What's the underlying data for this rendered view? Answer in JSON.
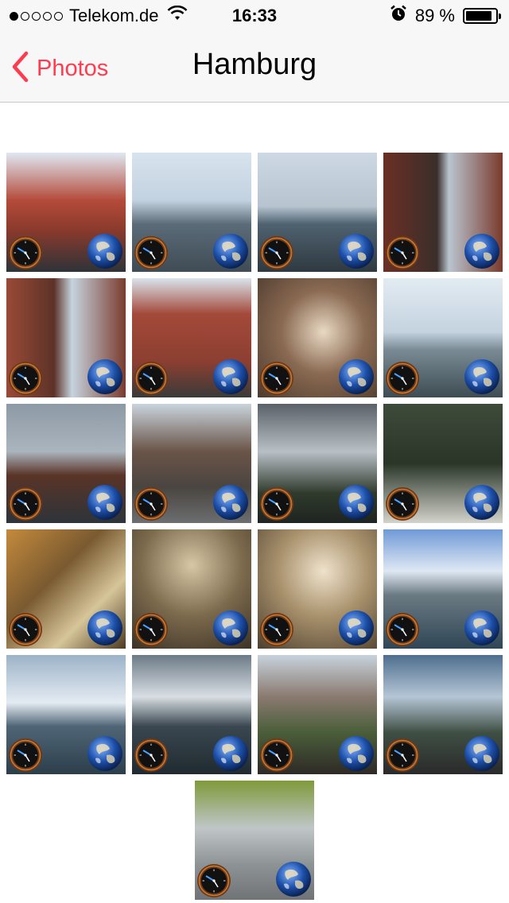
{
  "status_bar": {
    "carrier": "Telekom.de",
    "signal_filled": 1,
    "signal_total": 5,
    "time": "16:33",
    "battery": "89 %",
    "battery_level": 0.89
  },
  "nav": {
    "back_label": "Photos",
    "title": "Hamburg",
    "accent": "#ff3b4f"
  },
  "badges": {
    "left": "clock-icon",
    "right": "globe-icon"
  },
  "photos": [
    {
      "bg": "linear-gradient(#2f3a40 0%, #1d2426 100%)"
    },
    {
      "bg": "linear-gradient(#3b4a2c 0%, #2a3620 100%)"
    },
    {
      "bg": "linear-gradient(#5a6470 0%, #2c3136 100%)"
    },
    {
      "bg": "linear-gradient(#6d7a84 0%, #3a3f42 100%)"
    },
    {
      "bg": "linear-gradient(#dfe8f2 0%, #b44b3a 40%, #8a3a2c 65%, #2e3338 100%)"
    },
    {
      "bg": "linear-gradient(#d8e3ee 0%, #c2d2e0 40%, #5b6b78 60%, #3f4c55 100%)"
    },
    {
      "bg": "linear-gradient(#cdd8e4 0%, #b7c4cf 45%, #4f6270 60%, #2f3940 100%)"
    },
    {
      "bg": "linear-gradient(90deg, #6b2f24 0%, #3a2e2b 45%, #b9c5cf 55%, #7a3a2c 100%)"
    },
    {
      "bg": "linear-gradient(90deg, #9a4a36 0%, #5c3228 40%, #c6d3de 55%, #7a3b2d 100%)"
    },
    {
      "bg": "linear-gradient(#d9e3ec 0%, #a4493a 30%, #8c3f31 70%, #3a3a3a 100%)"
    },
    {
      "bg": "radial-gradient(circle at 55% 45%, #e9d9c4 0%, #8a6a52 45%, #4d3a2e 100%)"
    },
    {
      "bg": "linear-gradient(#e3ebf2 0%, #c4d3df 45%, #7a8b95 60%, #3e4c52 100%)"
    },
    {
      "bg": "linear-gradient(#8d99a4 0%, #aab5be 40%, #5a3428 60%, #2d3439 100%)"
    },
    {
      "bg": "linear-gradient(#c9d4dc 0%, #6a5448 40%, #4a4540 70%, #6c6e70 100%)"
    },
    {
      "bg": "linear-gradient(#5a6168 0%, #b8c0c6 40%, #2f3a2c 75%, #1e2420 100%)"
    },
    {
      "bg": "linear-gradient(#3e4a3a 0%, #2a3528 50%, #d3d3cc 100%)"
    },
    {
      "bg": "linear-gradient(135deg, #c48a3c 0%, #7a5a30 40%, #d7c59a 70%, #4c3a22 100%)"
    },
    {
      "bg": "radial-gradient(circle at 50% 30%, #d6c7a6 0%, #7c6a4d 50%, #3b3226 100%)"
    },
    {
      "bg": "radial-gradient(circle at 55% 35%, #efe2cc 0%, #a8916c 45%, #4d4030 100%)"
    },
    {
      "bg": "linear-gradient(#6f9ad6 0%, #dfe8f3 35%, #6b7a82 55%, #2f4656 100%)"
    },
    {
      "bg": "linear-gradient(#9cb3c8 0%, #e4ebf2 40%, #4f6576 60%, #2c3e4a 100%)"
    },
    {
      "bg": "linear-gradient(#6c7a86 0%, #d8dee4 35%, #3a4750 60%, #202a30 100%)"
    },
    {
      "bg": "linear-gradient(#c7d3dc 0%, #8a7a70 35%, #4a5e3a 65%, #2e2a26 100%)"
    },
    {
      "bg": "linear-gradient(#4e6e8e 0%, #b5c6d6 35%, #3f4f44 65%, #2a2a2a 100%)"
    },
    {
      "bg": "linear-gradient(#7f9a3a 0%, #c0c6c8 40%, #8e9396 70%, #6f7376 100%)"
    }
  ]
}
